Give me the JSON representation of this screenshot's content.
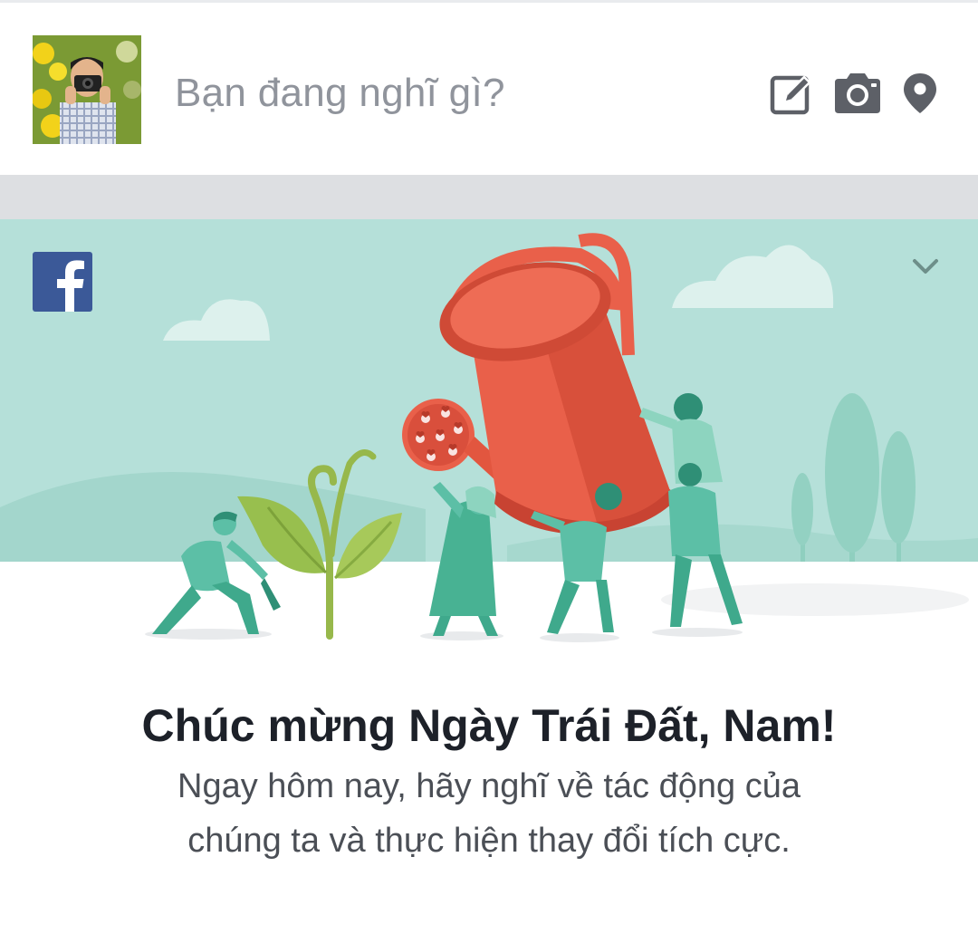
{
  "composer": {
    "placeholder": "Bạn đang nghĩ gì?",
    "actions": [
      {
        "icon": "edit-icon"
      },
      {
        "icon": "camera-icon"
      },
      {
        "icon": "location-pin-icon"
      }
    ]
  },
  "card": {
    "brand_icon": "facebook-logo-icon",
    "menu_icon": "chevron-down-icon",
    "title": "Chúc mừng Ngày Trái Đất, Nam!",
    "message": "Ngay hôm nay, hãy nghĩ về tác động của chúng ta và thực hiện thay đổi tích cực."
  },
  "colors": {
    "banner_sky": "#b5e0d9",
    "hills": "#a3d6cc",
    "figures": "#5cbfa6",
    "watering_can": "#e9604a",
    "facebook_blue": "#3b5998",
    "icon_gray": "#5d6067",
    "placeholder_gray": "#90949c",
    "separator": "#dddfe2"
  }
}
